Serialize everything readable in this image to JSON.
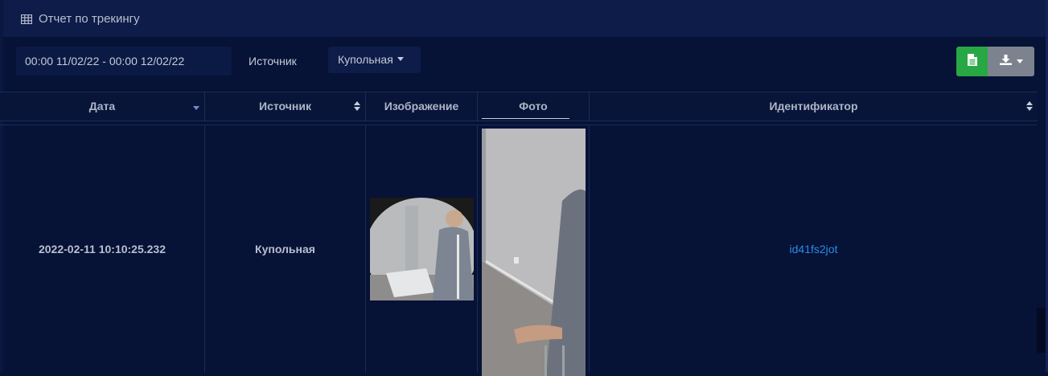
{
  "header": {
    "title": "Отчет по трекингу",
    "icon": "table-icon"
  },
  "toolbar": {
    "date_range": "00:00 11/02/22 - 00:00 12/02/22",
    "source_label": "Источник",
    "source_value": "Купольная",
    "report_icon": "file-icon",
    "export_icon": "download-icon"
  },
  "table": {
    "columns": [
      "Дата",
      "Источник",
      "Изображение",
      "Фото",
      "Идентификатор"
    ],
    "rows": [
      {
        "date": "2022-02-11 10:10:25.232",
        "source": "Купольная",
        "identifier": "id41fs2jot"
      }
    ]
  },
  "colors": {
    "background": "#061236",
    "header_bg": "#0d1c48",
    "report_button": "#28a745",
    "export_button": "#7c838f",
    "link": "#2a8be8"
  }
}
